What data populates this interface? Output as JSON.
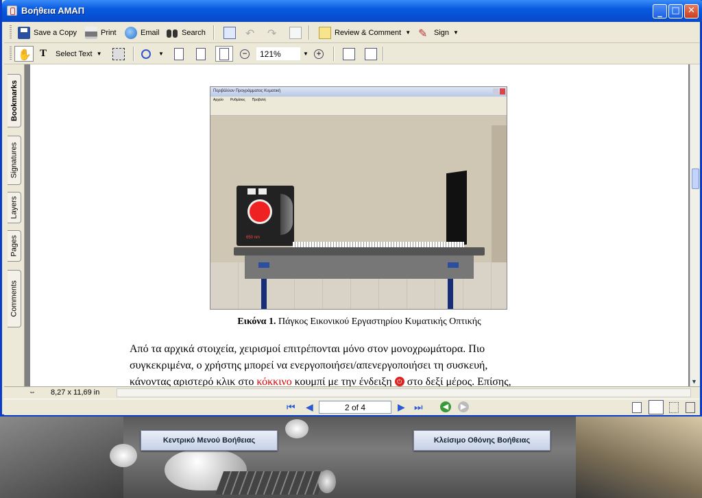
{
  "window": {
    "title": "Βοήθεια ΑΜΑΠ"
  },
  "toolbar1": {
    "save_copy": "Save a Copy",
    "print": "Print",
    "email": "Email",
    "search": "Search",
    "review_comment": "Review & Comment",
    "sign": "Sign"
  },
  "toolbar2": {
    "select_text": "Select Text",
    "zoom": "121%"
  },
  "sidebar": {
    "tabs": [
      {
        "label": "Bookmarks"
      },
      {
        "label": "Signatures"
      },
      {
        "label": "Layers"
      },
      {
        "label": "Pages"
      },
      {
        "label": "Comments"
      }
    ]
  },
  "document": {
    "figure_window_title": "Περιβάλλον Προγράμματος Κυματική",
    "figure_menu": [
      "Αρχείο",
      "Ρυθμίσεις",
      "Προβολή"
    ],
    "device_reading": "650 nm",
    "caption_bold": "Εικόνα 1.",
    "caption_text": "Πάγκος Εικονικού Εργαστηρίου Κυματικής Οπτικής",
    "para_line1": "Από τα αρχικά στοιχεία, χειρισμοί επιτρέπονται μόνο στον μονοχρωμάτορα. Πιο",
    "para_line2": "συγκεκριμένα, ο χρήστης μπορεί να ενεργοποιήσει/απενεργοποιήσει τη συσκευή,",
    "para_line3_a": "κάνοντας αριστερό κλικ στο",
    "para_line3_red": "κόκκινο",
    "para_line3_b": "κουμπί με την ένδειξη",
    "para_line3_c": "στο δεξί μέρος. Επίσης,"
  },
  "status": {
    "page_size": "8,27 x 11,69 in"
  },
  "navigation": {
    "page_indicator": "2 of 4"
  },
  "bottom_buttons": {
    "main_menu": "Κεντρικό Μενού Βοήθειας",
    "close_help": "Κλείσιμο Οθόνης Βοήθειας"
  },
  "colors": {
    "titlebar": "#0a5ae0",
    "toolbar": "#ece9d8",
    "link_red": "#dd0000"
  }
}
